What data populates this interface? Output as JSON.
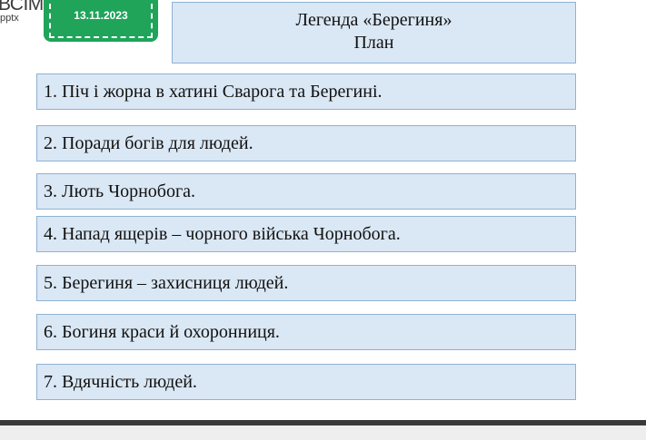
{
  "logo": {
    "text_main": "ВСІМ",
    "text_sub": "pptx"
  },
  "header": {
    "date": "13.11.2023"
  },
  "title": {
    "line1": "Легенда «Берегиня»",
    "line2": "План"
  },
  "plan_items": [
    "1. Піч і жорна в хатині Сварога та Берегині.",
    "2. Поради богів для людей.",
    "3. Лють Чорнобога.",
    "4. Напад ящерів – чорного війська Чорнобога.",
    "5. Берегиня – захисниця людей.",
    "6. Богиня краси й охоронниця.",
    "7. Вдячність людей."
  ],
  "colors": {
    "badge_green": "#1fa45a",
    "box_fill": "#dae7f4",
    "box_border": "#8fb2d3"
  }
}
